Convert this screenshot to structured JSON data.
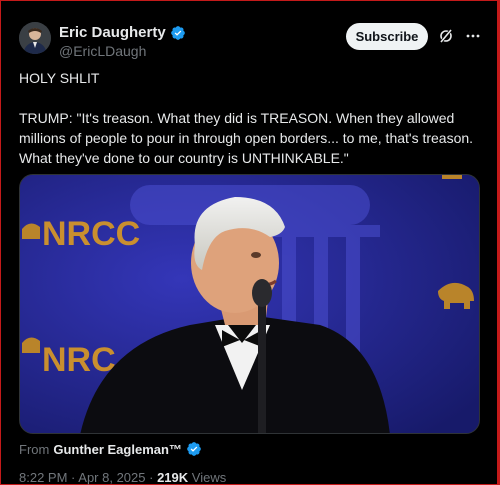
{
  "author": {
    "name": "Eric Daugherty",
    "handle": "@EricLDaugh"
  },
  "actions": {
    "subscribe_label": "Subscribe",
    "grok_icon": "grok-icon",
    "more_icon": "more-icon"
  },
  "tweet": {
    "line1": "HOLY SHLIT",
    "line2": "TRUMP: \"It's treason. What they did is TREASON. When they allowed millions of people to pour in through open borders... to me, that's treason. What they've done to our country is UNTHINKABLE.\""
  },
  "media": {
    "banner_text_1": "NRCC",
    "banner_text_2": "NRC"
  },
  "from": {
    "prefix": "From",
    "source": "Gunther Eagleman™"
  },
  "meta": {
    "time": "8:22 PM",
    "date": "Apr 8, 2025",
    "views_count": "219K",
    "views_label": "Views"
  },
  "colors": {
    "background": "#000000",
    "verified_blue": "#1d9bf0",
    "media_bg": "#1a1d7c"
  }
}
